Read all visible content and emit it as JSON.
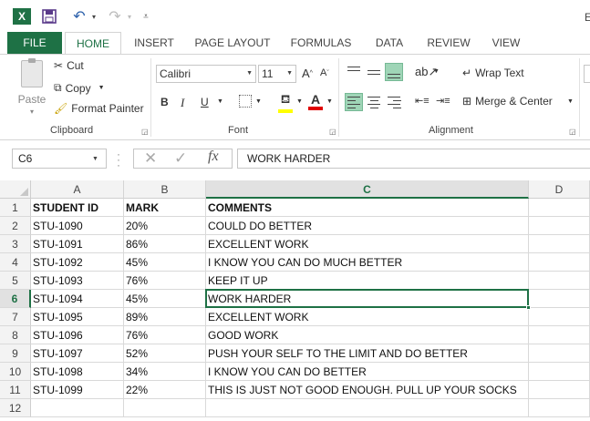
{
  "colors": {
    "brand": "#1e7145",
    "fill_highlight": "#ffff00",
    "font_color": "#e00000",
    "selected_align": "#9fd5b7"
  },
  "titlebar": {
    "title_fragment": "E",
    "icons": [
      "excel-icon",
      "save-icon",
      "undo-icon",
      "redo-icon",
      "customize-qat-icon"
    ]
  },
  "tabs": [
    "FILE",
    "HOME",
    "INSERT",
    "PAGE LAYOUT",
    "FORMULAS",
    "DATA",
    "REVIEW",
    "VIEW"
  ],
  "clipboard": {
    "paste": "Paste",
    "cut": "Cut",
    "copy": "Copy",
    "painter": "Format Painter",
    "label": "Clipboard"
  },
  "font": {
    "name": "Calibri",
    "size": "11",
    "grow": "A",
    "shrink": "A",
    "bold": "B",
    "italic": "I",
    "underline": "U",
    "color_glyph": "A",
    "label": "Font"
  },
  "alignment": {
    "wrap": "Wrap Text",
    "merge": "Merge & Center",
    "label": "Alignment"
  },
  "formula_bar": {
    "name_box": "C6",
    "fx": "fx",
    "value": "WORK HARDER"
  },
  "sheet": {
    "columns": [
      "A",
      "B",
      "C",
      "D"
    ],
    "selected_column": "C",
    "selected_row": "6",
    "rows": [
      {
        "num": "1",
        "cells": [
          "STUDENT ID",
          "MARK",
          "COMMENTS"
        ]
      },
      {
        "num": "2",
        "cells": [
          "STU-1090",
          "20%",
          "COULD DO BETTER"
        ]
      },
      {
        "num": "3",
        "cells": [
          "STU-1091",
          "86%",
          "EXCELLENT WORK"
        ]
      },
      {
        "num": "4",
        "cells": [
          "STU-1092",
          "45%",
          "I KNOW YOU CAN DO MUCH BETTER"
        ]
      },
      {
        "num": "5",
        "cells": [
          "STU-1093",
          "76%",
          "KEEP IT UP"
        ]
      },
      {
        "num": "6",
        "cells": [
          "STU-1094",
          "45%",
          "WORK HARDER"
        ]
      },
      {
        "num": "7",
        "cells": [
          "STU-1095",
          "89%",
          "EXCELLENT WORK"
        ]
      },
      {
        "num": "8",
        "cells": [
          "STU-1096",
          "76%",
          "GOOD WORK"
        ]
      },
      {
        "num": "9",
        "cells": [
          "STU-1097",
          "52%",
          "PUSH YOUR SELF TO THE LIMIT AND DO BETTER"
        ]
      },
      {
        "num": "10",
        "cells": [
          "STU-1098",
          "34%",
          "I KNOW YOU CAN DO BETTER"
        ]
      },
      {
        "num": "11",
        "cells": [
          "STU-1099",
          "22%",
          "THIS IS JUST NOT GOOD ENOUGH. PULL UP YOUR SOCKS"
        ]
      },
      {
        "num": "12",
        "cells": [
          "",
          "",
          ""
        ]
      }
    ]
  }
}
